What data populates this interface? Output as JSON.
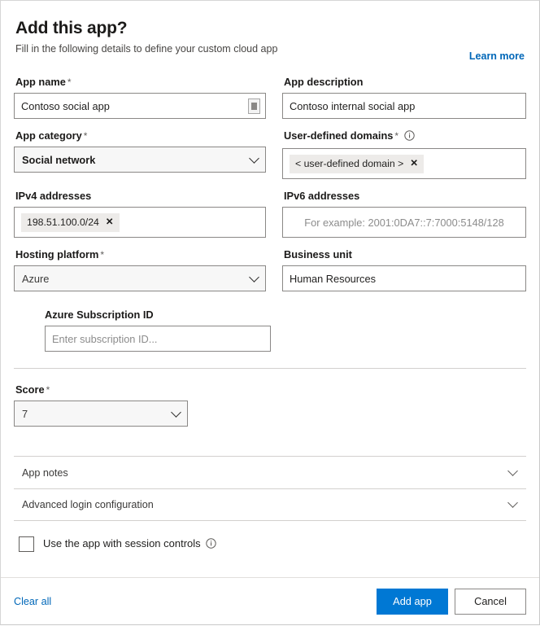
{
  "header": {
    "title": "Add this app?",
    "subtitle": "Fill in the following details to define your custom cloud app",
    "learn_more": "Learn more"
  },
  "colors": {
    "accent": "#0078d4",
    "link": "#0067b8",
    "chip_bg": "#edebe9",
    "border": "#8a8886"
  },
  "fields": {
    "app_name": {
      "label": "App name",
      "required": "*",
      "value": "Contoso social app",
      "icon": "text-field-icon"
    },
    "app_description": {
      "label": "App description",
      "required": "",
      "value": "Contoso internal social app"
    },
    "app_category": {
      "label": "App category",
      "required": "*",
      "value": "Social network"
    },
    "user_defined_domains": {
      "label": "User-defined domains",
      "required": "*",
      "info": "info-icon",
      "chips": [
        "< user-defined domain >"
      ]
    },
    "ipv4_addresses": {
      "label": "IPv4 addresses",
      "required": "",
      "chips": [
        "198.51.100.0/24"
      ]
    },
    "ipv6_addresses": {
      "label": "IPv6 addresses",
      "required": "",
      "value": "",
      "placeholder": "For example: 2001:0DA7::7:7000:5148/128"
    },
    "hosting_platform": {
      "label": "Hosting platform",
      "required": "*",
      "value": "Azure"
    },
    "business_unit": {
      "label": "Business unit",
      "required": "",
      "value": "Human Resources"
    },
    "azure_subscription_id": {
      "label": "Azure Subscription ID",
      "required": "",
      "value": "",
      "placeholder": "Enter subscription ID..."
    },
    "score": {
      "label": "Score",
      "required": "*",
      "value": "7"
    }
  },
  "accordions": [
    {
      "label": "App notes"
    },
    {
      "label": "Advanced login configuration"
    }
  ],
  "session_controls": {
    "label": "Use the app with session controls",
    "checked": false,
    "info": "info-icon"
  },
  "footer": {
    "clear_all": "Clear all",
    "primary": "Add app",
    "secondary": "Cancel"
  }
}
